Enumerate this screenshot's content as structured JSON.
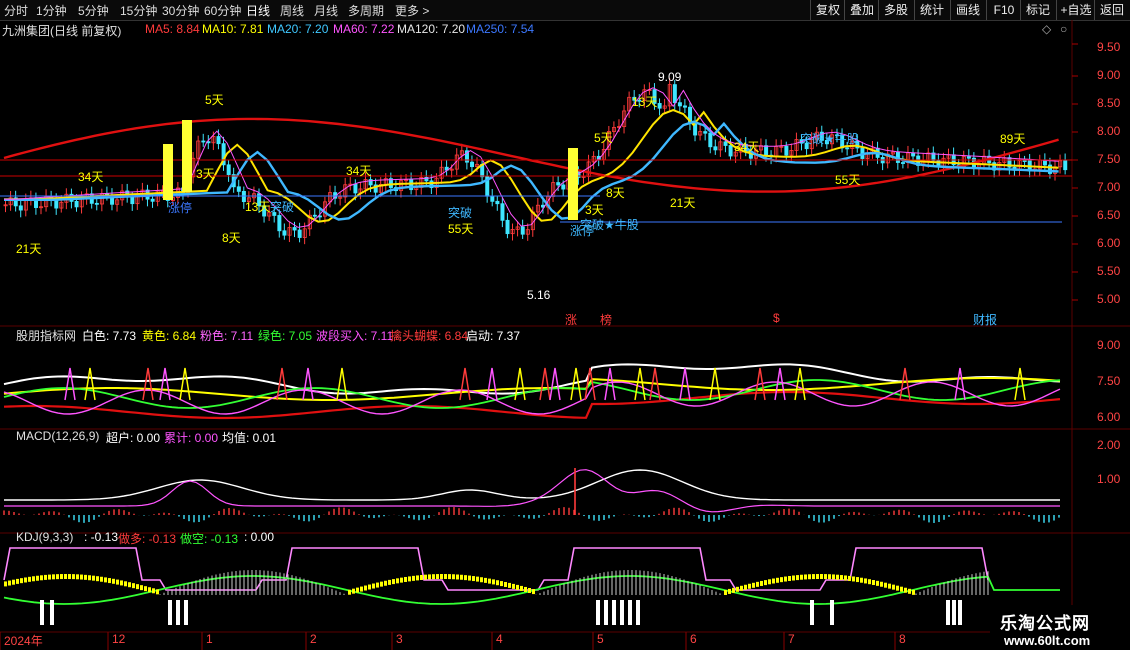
{
  "toolbar": {
    "periods": [
      "分时",
      "1分钟",
      "5分钟",
      "15分钟",
      "30分钟",
      "60分钟",
      "日线",
      "周线",
      "月线",
      "多周期",
      "更多 >"
    ],
    "active_period": "日线",
    "right_buttons": [
      "复权",
      "叠加",
      "多股",
      "统计",
      "画线",
      "F10",
      "标记",
      "+自选",
      "返回"
    ]
  },
  "main_panel": {
    "stock_title": "九洲集团(日线 前复权)",
    "indicators": [
      {
        "label": "MA5: 8.84",
        "color": "#ff3b3b"
      },
      {
        "label": "MA10: 7.81",
        "color": "#ffff00"
      },
      {
        "label": "MA20: 7.20",
        "color": "#3fc8ff"
      },
      {
        "label": "MA60: 7.22",
        "color": "#ff55ff"
      },
      {
        "label": "MA120: 7.20",
        "color": "#e6e6e6"
      },
      {
        "label": "MA250: 7.54",
        "color": "#3c78ff"
      }
    ],
    "y_ticks": [
      "9.50",
      "9.00",
      "8.50",
      "8.00",
      "7.50",
      "7.00",
      "6.50",
      "6.00",
      "5.50",
      "5.00"
    ],
    "high_annotation": "9.09",
    "low_annotation": "5.16",
    "day_labels": [
      "21天",
      "34天",
      "5天",
      "3天",
      "8天",
      "13天",
      "34天",
      "55天",
      "5天",
      "8天",
      "3天",
      "13天",
      "21天",
      "34天",
      "55天",
      "89天"
    ],
    "signal_labels": [
      "涨停",
      "突破",
      "突破",
      "涨停",
      "突破★牛股",
      "突破★牛股"
    ],
    "bottom_marks": [
      "涨",
      "榜",
      "$",
      "财报"
    ]
  },
  "indicator_panel": {
    "name": "股朋指标网",
    "fields": [
      {
        "label": "白色: 7.73",
        "color": "#ffffff"
      },
      {
        "label": "黄色: 6.84",
        "color": "#ffff00"
      },
      {
        "label": "粉色: 7.11",
        "color": "#ff66ff"
      },
      {
        "label": "绿色: 7.05",
        "color": "#33ff33"
      },
      {
        "label": "波段买入: 7.11",
        "color": "#ff55ff"
      },
      {
        "label": "擒头蝴蝶: 6.84",
        "color": "#ff3b3b"
      },
      {
        "label": "启动: 7.37",
        "color": "#ffffff"
      }
    ],
    "y_ticks": [
      "9.00",
      "7.50",
      "6.00"
    ]
  },
  "macd_panel": {
    "name": "MACD(12,26,9)",
    "fields": [
      {
        "label": "超户: 0.00",
        "color": "#ffffff"
      },
      {
        "label": "累计: 0.00",
        "color": "#ff55ff"
      },
      {
        "label": "均值: 0.01",
        "color": "#ffffff"
      }
    ],
    "y_ticks": [
      "2.00",
      "1.00"
    ]
  },
  "kdj_panel": {
    "name": "KDJ(9,3,3)",
    "fields": [
      {
        "label": ": -0.13",
        "color": "#ffffff"
      },
      {
        "label": "做多: -0.13",
        "color": "#ff3b3b"
      },
      {
        "label": "做空: -0.13",
        "color": "#33ff33"
      },
      {
        "label": ": 0.00",
        "color": "#ffffff"
      }
    ]
  },
  "x_axis": [
    "2024年",
    "12",
    "1",
    "2",
    "3",
    "4",
    "5",
    "6",
    "7",
    "8"
  ],
  "watermark": {
    "line1": "乐淘公式网",
    "line2": "www.60lt.com"
  },
  "colors": {
    "up": "#ff3b3b",
    "down": "#3fe6ff",
    "grid": "#5a0000"
  }
}
